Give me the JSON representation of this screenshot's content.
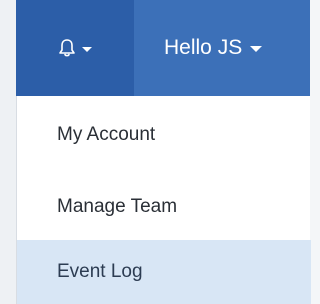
{
  "navbar": {
    "notifications": {
      "icon": "bell-icon"
    },
    "user_menu": {
      "label": "Hello JS",
      "icon": "caret-down-icon"
    }
  },
  "dropdown": {
    "items": [
      {
        "label": "My Account",
        "active": false
      },
      {
        "label": "Manage Team",
        "active": false
      },
      {
        "label": "Event Log",
        "active": true
      }
    ]
  },
  "colors": {
    "navbar_bg": "#3c70b8",
    "bell_button_bg": "#2c5ea8",
    "active_item_bg": "#d8e6f5",
    "text": "#2a2f36"
  }
}
